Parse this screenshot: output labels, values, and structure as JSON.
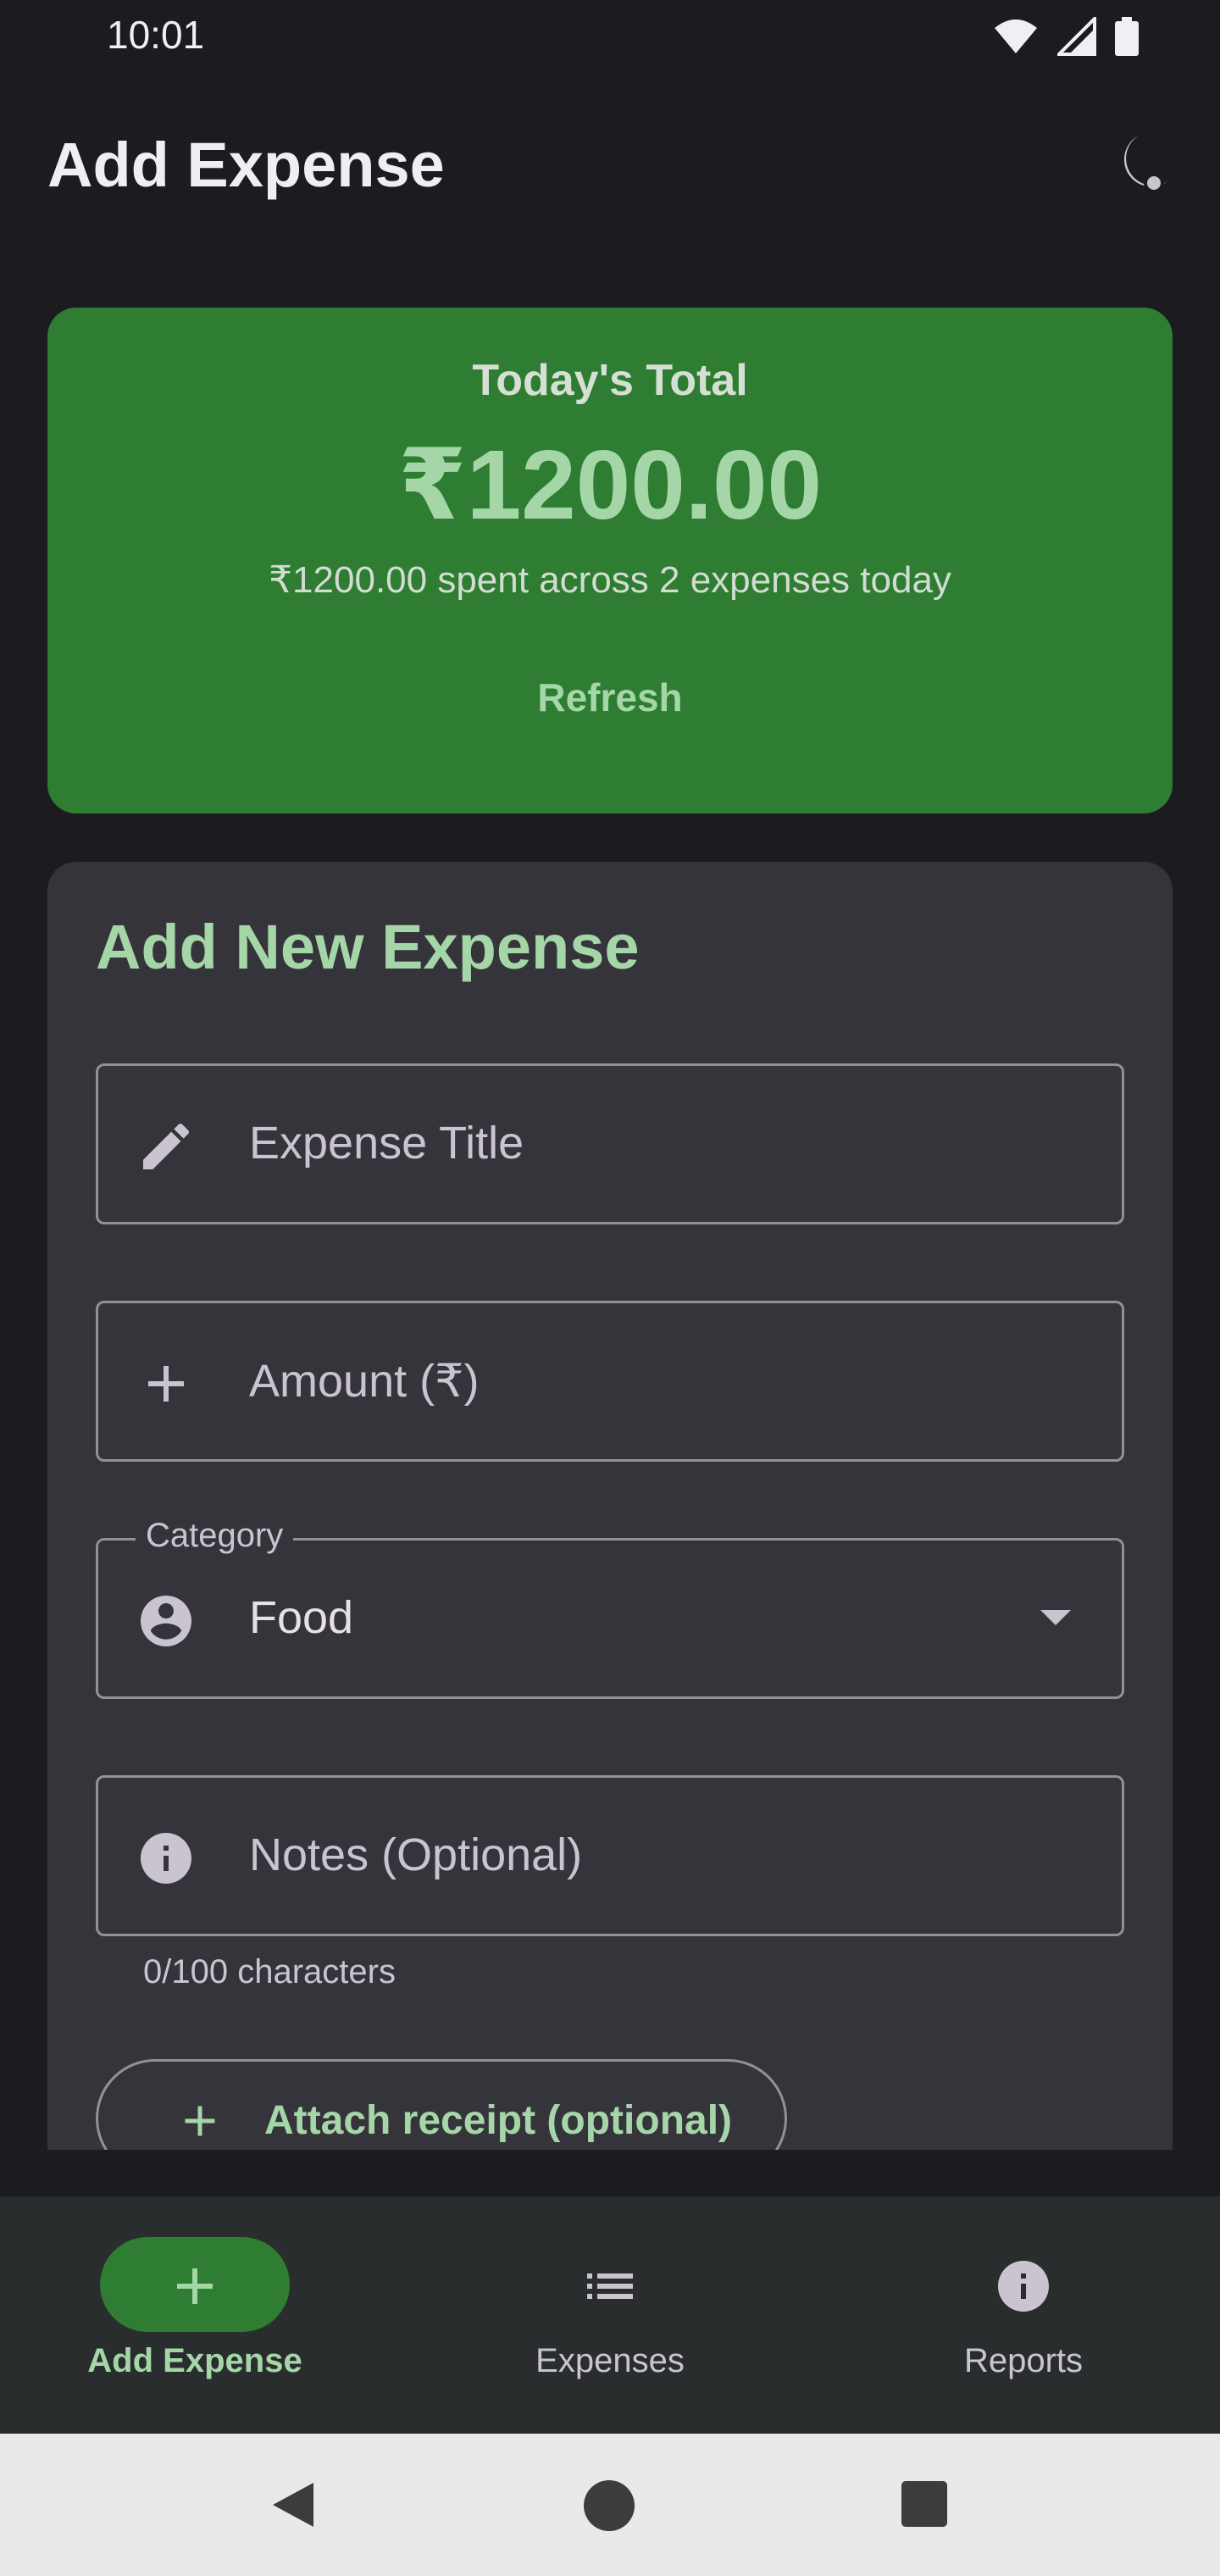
{
  "status_bar": {
    "time": "10:01"
  },
  "app_bar": {
    "title": "Add Expense"
  },
  "summary": {
    "label": "Today's Total",
    "amount": "₹1200.00",
    "subtitle": "₹1200.00 spent across 2 expenses today",
    "refresh_label": "Refresh"
  },
  "form": {
    "title": "Add New Expense",
    "title_field": {
      "placeholder": "Expense Title",
      "icon": "pencil-icon"
    },
    "amount_field": {
      "placeholder": "Amount (₹)",
      "icon": "plus-icon"
    },
    "category_field": {
      "label": "Category",
      "value": "Food",
      "icon": "person-circle-icon"
    },
    "notes_field": {
      "placeholder": "Notes (Optional)",
      "icon": "info-icon",
      "helper": "0/100 characters"
    },
    "attach_label": "Attach receipt (optional)"
  },
  "bottom_nav": {
    "items": [
      {
        "label": "Add Expense",
        "icon": "plus-icon",
        "active": true
      },
      {
        "label": "Expenses",
        "icon": "list-icon",
        "active": false
      },
      {
        "label": "Reports",
        "icon": "info-icon",
        "active": false
      }
    ]
  },
  "colors": {
    "background": "#1c1b1f",
    "accent_green": "#2e7d32",
    "accent_light": "#a5d6a7",
    "surface": "#36343b"
  }
}
